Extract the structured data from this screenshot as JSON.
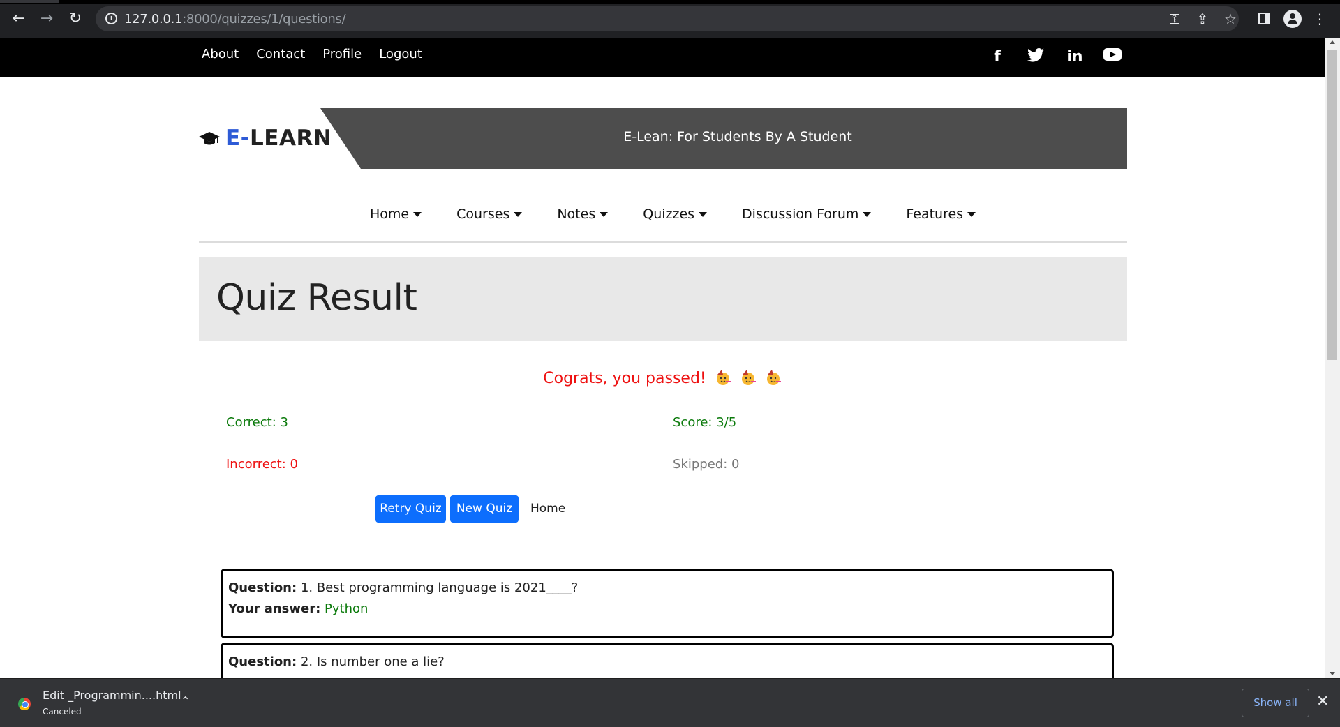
{
  "browser": {
    "url_host": "127.0.0.1",
    "url_rest": ":8000/quizzes/1/questions/"
  },
  "topbar": {
    "links": [
      "About",
      "Contact",
      "Profile",
      "Logout"
    ],
    "social_icons": [
      "facebook-icon",
      "twitter-icon",
      "linkedin-icon",
      "youtube-icon"
    ]
  },
  "header": {
    "logo_accent": "E-",
    "logo_rest": "LEARN",
    "tagline": "E-Lean: For Students By A Student"
  },
  "nav": {
    "items": [
      "Home",
      "Courses",
      "Notes",
      "Quizzes",
      "Discussion Forum",
      "Features"
    ]
  },
  "result": {
    "title": "Quiz Result",
    "message": "Cograts, you passed!",
    "correct": "Correct: 3",
    "incorrect": "Incorrect: 0",
    "score": "Score: 3/5",
    "skipped": "Skipped: 0"
  },
  "actions": {
    "retry": "Retry Quiz",
    "new": "New Quiz",
    "home": "Home"
  },
  "questions": [
    {
      "q_label": "Question:",
      "q_text": "1. Best programming language is 2021____?",
      "a_label": "Your answer:",
      "a_text": "Python"
    },
    {
      "q_label": "Question:",
      "q_text": "2. Is number one a lie?"
    }
  ],
  "downloads": {
    "filename": "Edit _Programmin....html",
    "status": "Canceled",
    "show_all": "Show all"
  },
  "colors": {
    "accent_blue": "#0d6efd",
    "logo_blue": "#2e5bd6",
    "success_green": "#0b7a0b",
    "error_red": "#ee1111",
    "banner_grey": "#4d4d4d"
  }
}
